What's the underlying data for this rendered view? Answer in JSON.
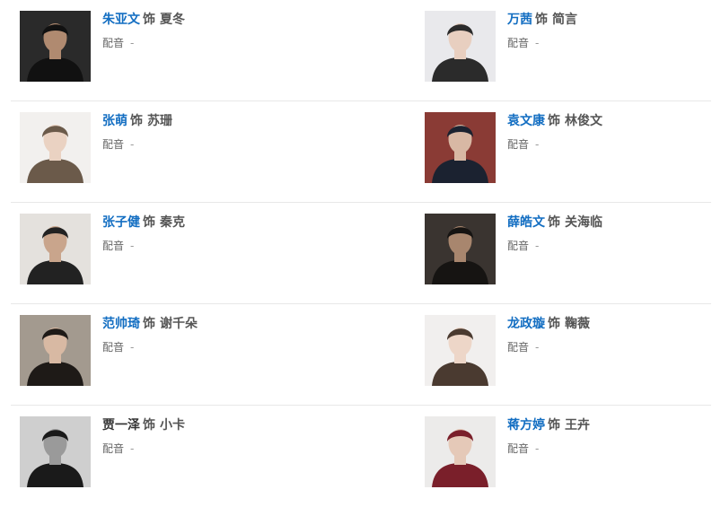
{
  "role_prefix": "饰",
  "dub_label": "配音",
  "rows": [
    {
      "left": {
        "actor": "朱亚文",
        "role": "夏冬",
        "linked": true,
        "dub": "-",
        "photo_icon": "actor-portrait-icon",
        "photo_bg": "#2a2a2a",
        "photo_fg": "#111111",
        "skin": "#b08a70"
      },
      "right": {
        "actor": "万茜",
        "role": "简言",
        "linked": true,
        "dub": "-",
        "photo_icon": "actor-portrait-icon",
        "photo_bg": "#e9e9ec",
        "photo_fg": "#2b2b2b",
        "skin": "#e8cfc0"
      }
    },
    {
      "left": {
        "actor": "张萌",
        "role": "苏珊",
        "linked": true,
        "dub": "-",
        "photo_icon": "actor-portrait-icon",
        "photo_bg": "#f2f0ee",
        "photo_fg": "#6b5a4a",
        "skin": "#ead2c2"
      },
      "right": {
        "actor": "袁文康",
        "role": "林俊文",
        "linked": true,
        "dub": "-",
        "photo_icon": "actor-portrait-icon",
        "photo_bg": "#8a3b35",
        "photo_fg": "#1b2230",
        "skin": "#d8b8a4"
      }
    },
    {
      "left": {
        "actor": "张子健",
        "role": "秦克",
        "linked": true,
        "dub": "-",
        "photo_icon": "actor-portrait-icon",
        "photo_bg": "#e4e1dd",
        "photo_fg": "#222222",
        "skin": "#c9a58c"
      },
      "right": {
        "actor": "薛皓文",
        "role": "关海临",
        "linked": true,
        "dub": "-",
        "photo_icon": "actor-portrait-icon",
        "photo_bg": "#3a3430",
        "photo_fg": "#161412",
        "skin": "#a8866e"
      }
    },
    {
      "left": {
        "actor": "范帅琦",
        "role": "谢千朵",
        "linked": true,
        "dub": "-",
        "photo_icon": "actor-portrait-icon",
        "photo_bg": "#a39a8f",
        "photo_fg": "#1e1a17",
        "skin": "#d8b9a3"
      },
      "right": {
        "actor": "龙政璇",
        "role": "鞠薇",
        "linked": true,
        "dub": "-",
        "photo_icon": "actor-portrait-icon",
        "photo_bg": "#f1efee",
        "photo_fg": "#4a3a30",
        "skin": "#edd6c8"
      }
    },
    {
      "left": {
        "actor": "贾一泽",
        "role": "小卡",
        "linked": false,
        "dub": "-",
        "photo_icon": "actor-portrait-icon",
        "photo_bg": "#cfcfcf",
        "photo_fg": "#1a1a1a",
        "skin": "#9a9a9a"
      },
      "right": {
        "actor": "蒋方婷",
        "role": "王卉",
        "linked": true,
        "dub": "-",
        "photo_icon": "actor-portrait-icon",
        "photo_bg": "#ecebea",
        "photo_fg": "#7a1f2a",
        "skin": "#e5c9b8"
      }
    }
  ]
}
